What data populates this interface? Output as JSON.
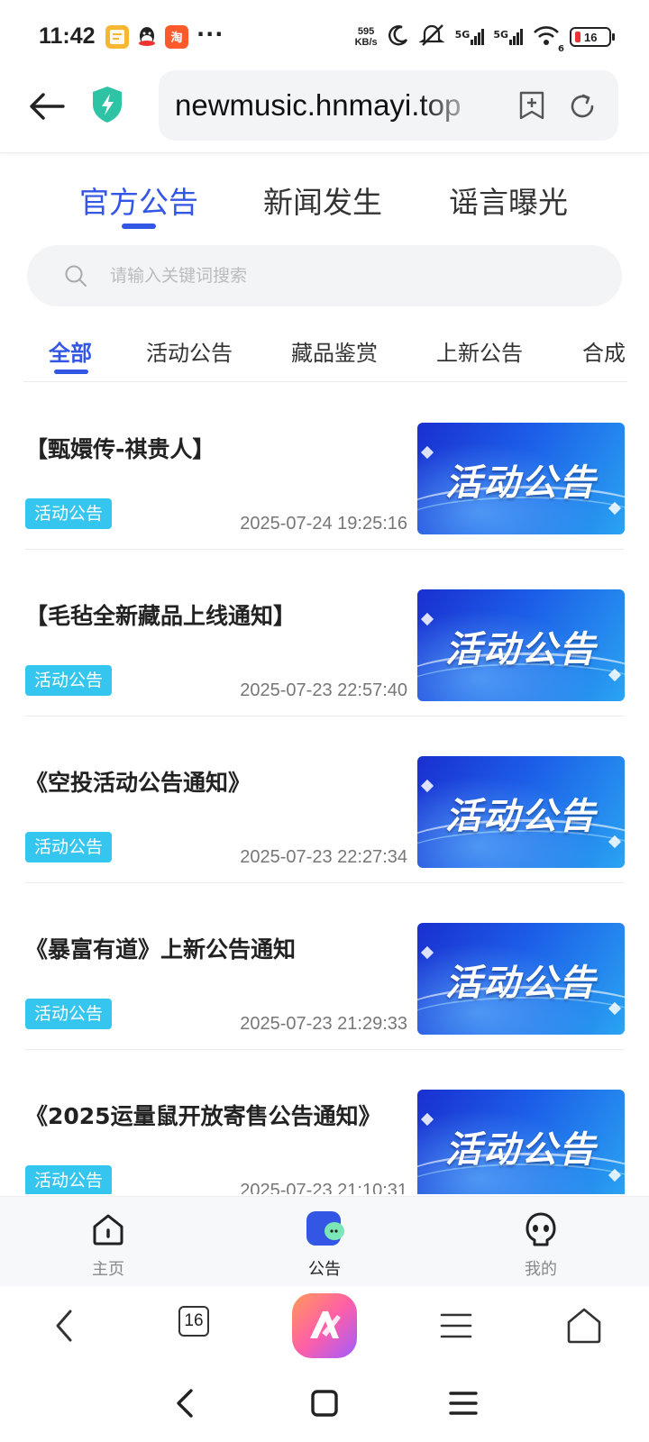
{
  "status_bar": {
    "time": "11:42",
    "speed_top": "595",
    "speed_bottom": "KB/s",
    "sig1": "5G",
    "sig2": "5G",
    "wifi_sub": "6",
    "battery": "16",
    "app_icons": [
      "notes-app-icon",
      "qq-icon",
      "taobao-icon"
    ],
    "more": "···"
  },
  "browser": {
    "url": "newmusic.hnmayi.top",
    "accent": "#3356e5",
    "shield_color": "#2fc3a6"
  },
  "top_tabs": [
    {
      "label": "官方公告",
      "active": true
    },
    {
      "label": "新闻发生",
      "active": false
    },
    {
      "label": "谣言曝光",
      "active": false
    }
  ],
  "search": {
    "placeholder": "请输入关键词搜索"
  },
  "category_tabs": [
    {
      "label": "全部",
      "active": true
    },
    {
      "label": "活动公告",
      "active": false
    },
    {
      "label": "藏品鉴赏",
      "active": false
    },
    {
      "label": "上新公告",
      "active": false
    },
    {
      "label": "合成",
      "active": false
    }
  ],
  "articles": [
    {
      "title": "【甄嬛传-祺贵人】",
      "tag": "活动公告",
      "date": "2025-07-24 19:25:16",
      "thumb_text": "活动公告"
    },
    {
      "title": "【毛毡全新藏品上线通知】",
      "tag": "活动公告",
      "date": "2025-07-23 22:57:40",
      "thumb_text": "活动公告"
    },
    {
      "title": "《空投活动公告通知》",
      "tag": "活动公告",
      "date": "2025-07-23 22:27:34",
      "thumb_text": "活动公告"
    },
    {
      "title": "《暴富有道》上新公告通知",
      "tag": "活动公告",
      "date": "2025-07-23 21:29:33",
      "thumb_text": "活动公告"
    },
    {
      "title": "《2025运量鼠开放寄售公告通知》",
      "tag": "活动公告",
      "date": "2025-07-23 21:10:31",
      "thumb_text": "活动公告"
    }
  ],
  "app_nav": [
    {
      "label": "主页",
      "icon": "home-icon",
      "active": false
    },
    {
      "label": "公告",
      "icon": "announcement-icon",
      "active": true
    },
    {
      "label": "我的",
      "icon": "profile-icon",
      "active": false
    }
  ],
  "browser_nav": {
    "tab_count": "16"
  }
}
